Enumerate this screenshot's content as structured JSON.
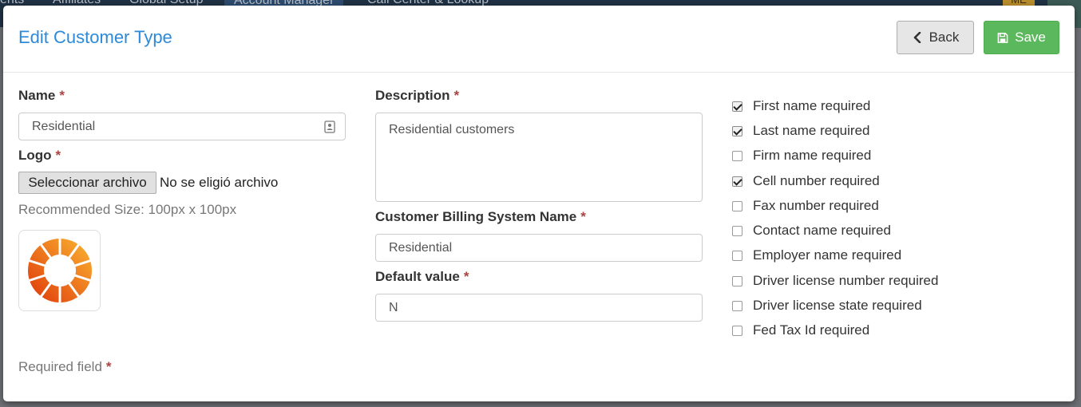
{
  "background_nav": {
    "items": [
      "ents",
      "Affiliates",
      "Global Setup",
      "Account Manager",
      "Call Center & Lookup"
    ],
    "badge": "ME"
  },
  "modal": {
    "title": "Edit Customer Type",
    "back_label": "Back",
    "save_label": "Save"
  },
  "form": {
    "name": {
      "label": "Name",
      "required_mark": "*",
      "value": "Residential"
    },
    "logo": {
      "label": "Logo",
      "required_mark": "*",
      "file_button": "Seleccionar archivo",
      "file_status": "No se eligió archivo",
      "recommended": "Recommended Size: 100px x 100px"
    },
    "description": {
      "label": "Description",
      "required_mark": "*",
      "value": "Residential customers"
    },
    "billing_name": {
      "label": "Customer Billing System Name",
      "required_mark": "*",
      "value": "Residential"
    },
    "default_value": {
      "label": "Default value",
      "required_mark": "*",
      "value": "N"
    },
    "required_note": {
      "text": "Required field",
      "mark": "*"
    }
  },
  "checkboxes": [
    {
      "label": "First name required",
      "checked": true
    },
    {
      "label": "Last name required",
      "checked": true
    },
    {
      "label": "Firm name required",
      "checked": false
    },
    {
      "label": "Cell number required",
      "checked": true
    },
    {
      "label": "Fax number required",
      "checked": false
    },
    {
      "label": "Contact name required",
      "checked": false
    },
    {
      "label": "Employer name required",
      "checked": false
    },
    {
      "label": "Driver license number required",
      "checked": false
    },
    {
      "label": "Driver license state required",
      "checked": false
    },
    {
      "label": "Fed Tax Id required",
      "checked": false
    }
  ],
  "colors": {
    "title": "#2c8ad8",
    "save": "#5cb85c",
    "required": "#a94442",
    "logo_gradient": [
      "#f7a62c",
      "#e2470f"
    ]
  },
  "icons": {
    "back": "chevron-left-icon",
    "save": "floppy-disk-icon",
    "contact": "contact-card-icon",
    "logo": "ring-segments-logo"
  }
}
